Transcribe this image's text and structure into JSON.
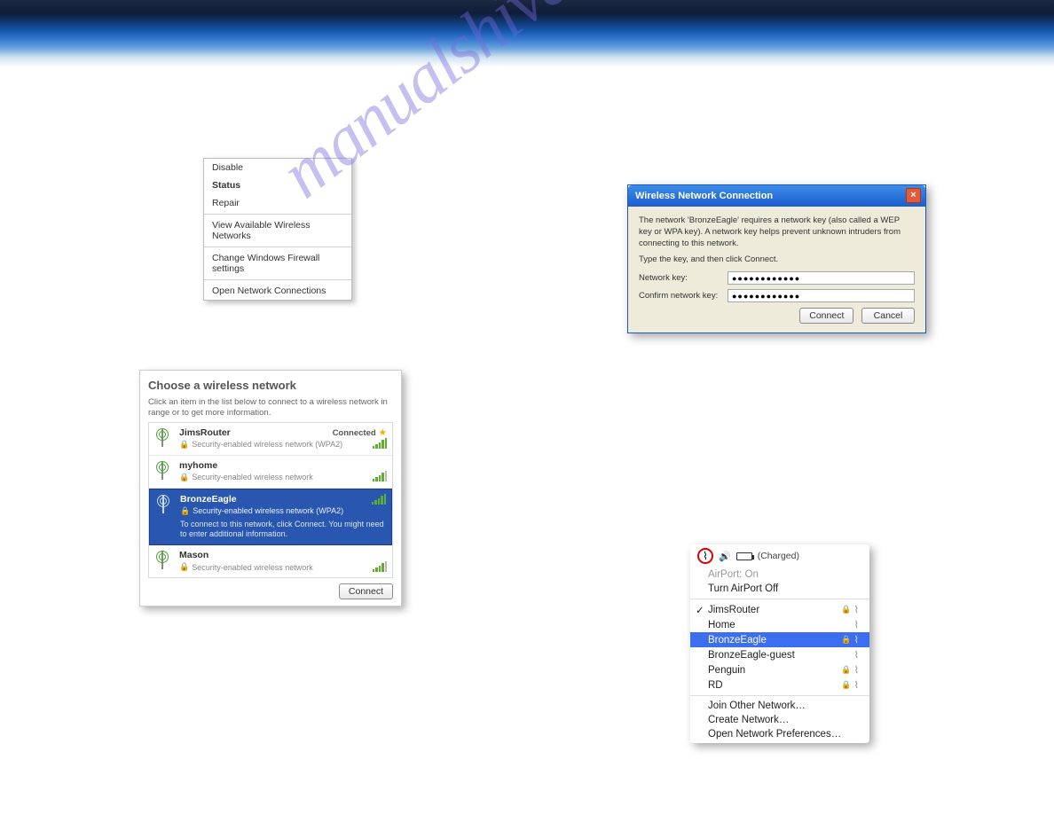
{
  "watermark": "manualshive.com",
  "context_menu": {
    "disable": "Disable",
    "status": "Status",
    "repair": "Repair",
    "view_networks": "View Available Wireless Networks",
    "firewall": "Change Windows Firewall settings",
    "open_conn": "Open Network Connections"
  },
  "picker": {
    "title": "Choose a wireless network",
    "hint": "Click an item in the list below to connect to a wireless network in range or to get more information.",
    "connect": "Connect",
    "status_connected": "Connected",
    "networks": [
      {
        "name": "JimsRouter",
        "sec": "Security-enabled wireless network (WPA2)",
        "connected": true
      },
      {
        "name": "myhome",
        "sec": "Security-enabled wireless network"
      },
      {
        "name": "BronzeEagle",
        "sec": "Security-enabled wireless network (WPA2)",
        "extra": "To connect to this network, click Connect. You might need to enter additional information.",
        "selected": true
      },
      {
        "name": "Mason",
        "sec": "Security-enabled wireless network"
      }
    ]
  },
  "dialog": {
    "title": "Wireless Network Connection",
    "msg1": "The network 'BronzeEagle' requires a network key (also called a WEP key or WPA key). A network key helps prevent unknown intruders from connecting to this network.",
    "msg2": "Type the key, and then click Connect.",
    "lbl_key": "Network key:",
    "lbl_confirm": "Confirm network key:",
    "val_key": "●●●●●●●●●●●●",
    "val_confirm": "●●●●●●●●●●●●",
    "btn_connect": "Connect",
    "btn_cancel": "Cancel"
  },
  "mac": {
    "charged": "(Charged)",
    "airport_on": "AirPort: On",
    "turn_off": "Turn AirPort Off",
    "join": "Join Other Network…",
    "create": "Create Network…",
    "prefs": "Open Network Preferences…",
    "networks": [
      {
        "name": "JimsRouter",
        "lock": true,
        "checked": true
      },
      {
        "name": "Home",
        "lock": false
      },
      {
        "name": "BronzeEagle",
        "lock": true,
        "selected": true
      },
      {
        "name": "BronzeEagle-guest",
        "lock": false
      },
      {
        "name": "Penguin",
        "lock": true
      },
      {
        "name": "RD",
        "lock": true
      }
    ]
  }
}
